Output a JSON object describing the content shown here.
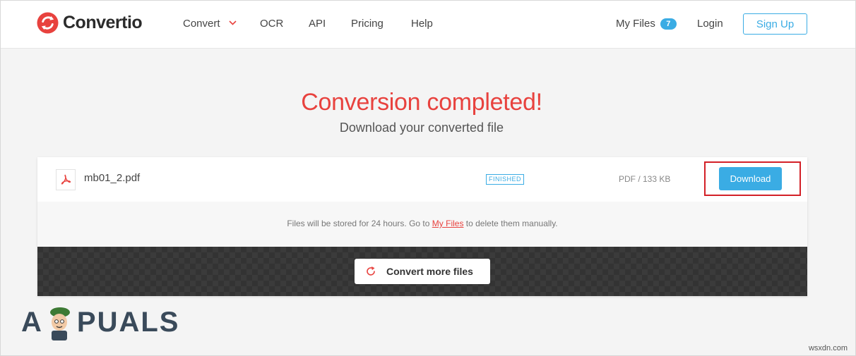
{
  "brand": {
    "name": "Convertio",
    "accent": "#e8423e",
    "blue": "#3aace4"
  },
  "nav": {
    "items": [
      {
        "label": "Convert"
      },
      {
        "label": "OCR"
      },
      {
        "label": "API"
      },
      {
        "label": "Pricing"
      },
      {
        "label": "Help"
      }
    ],
    "my_files_label": "My Files",
    "my_files_count": "7",
    "login_label": "Login",
    "signup_label": "Sign Up"
  },
  "main": {
    "title": "Conversion completed!",
    "subtitle": "Download your converted file"
  },
  "file": {
    "name": "mb01_2.pdf",
    "status": "FINISHED",
    "info": "PDF / 133 KB",
    "download_label": "Download",
    "icon": "pdf-icon"
  },
  "notice": {
    "before": "Files will be stored for 24 hours. Go to ",
    "link": "My Files",
    "after": " to delete them manually."
  },
  "convert_more_label": "Convert more files",
  "watermark": {
    "letters_left": "A",
    "letters_right": "PUALS"
  },
  "site_mark": "wsxdn.com"
}
